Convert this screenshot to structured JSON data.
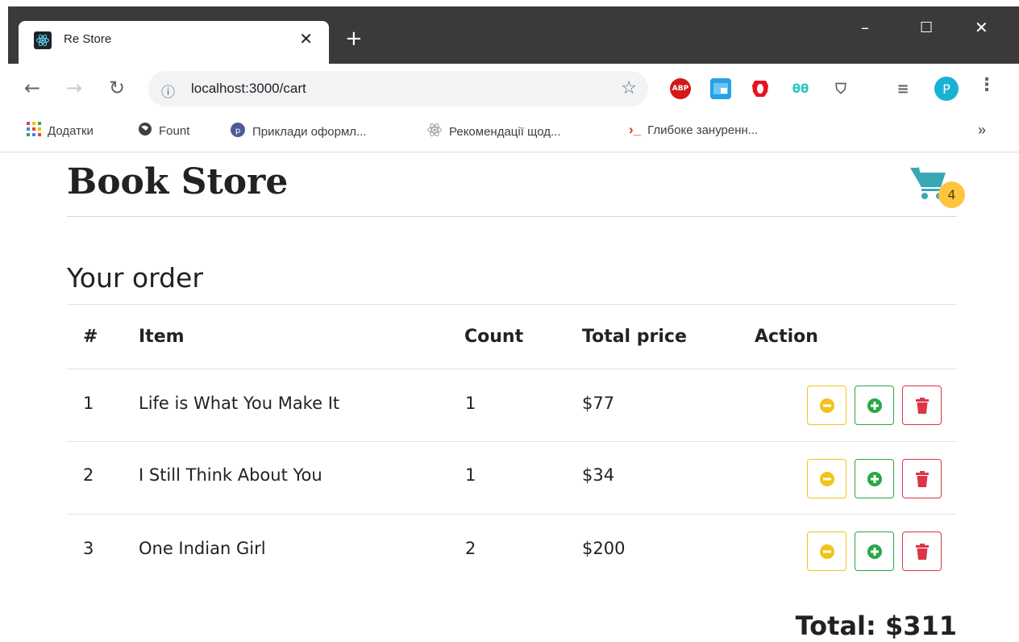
{
  "browser": {
    "tab_title": "Re Store",
    "tab_close": "✕",
    "new_tab": "+",
    "window": {
      "minimize": "–",
      "maximize": "☐",
      "close": "✕"
    },
    "url": "localhost:3000/cart",
    "extensions": [
      "ABP",
      "window-ext",
      "opera-ext",
      "hex-ext",
      "shield-ext"
    ],
    "profile_initial": "P",
    "bookmarks": [
      {
        "icon": "apps-grid-icon",
        "label": "Додатки"
      },
      {
        "icon": "globe-icon",
        "label": "Fount"
      },
      {
        "icon": "php-icon",
        "label": "Приклади оформл..."
      },
      {
        "icon": "atom-icon",
        "label": "Рекомендації щод..."
      },
      {
        "icon": "terminal-icon",
        "label": "Глибоке зануренн..."
      }
    ],
    "bookmarks_more": "»"
  },
  "header": {
    "brand": "Book Store",
    "cart_count": "4"
  },
  "order": {
    "title": "Your order",
    "columns": [
      "#",
      "Item",
      "Count",
      "Total price",
      "Action"
    ],
    "rows": [
      {
        "num": "1",
        "item": "Life is What You Make It",
        "count": "1",
        "price": "$77"
      },
      {
        "num": "2",
        "item": "I Still Think About You",
        "count": "1",
        "price": "$34"
      },
      {
        "num": "3",
        "item": "One Indian Girl",
        "count": "2",
        "price": "$200"
      }
    ],
    "total": "Total: $311"
  },
  "colors": {
    "warning": "#f0c419",
    "success": "#28a745",
    "danger": "#dc3545",
    "cart": "#3aa7b7",
    "badge": "#fdc540"
  }
}
